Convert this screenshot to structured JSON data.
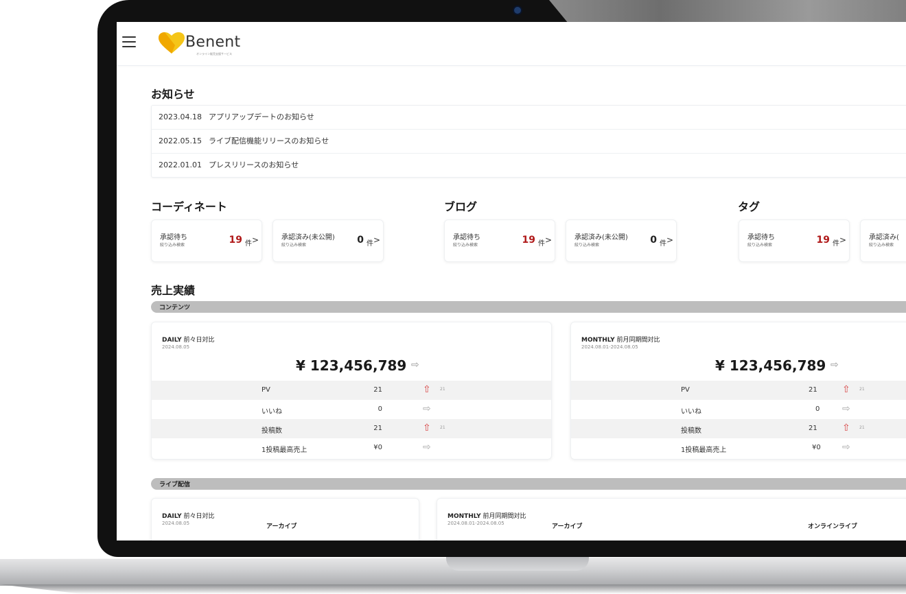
{
  "app": {
    "logo_name": "Benent",
    "logo_tagline": "オンライン販売支援サービス",
    "accent_color": "#b01a1a",
    "logo_color": "#f5c518"
  },
  "news": {
    "title": "お知らせ",
    "items": [
      {
        "date": "2023.04.18",
        "text": "アプリアップデートのお知らせ"
      },
      {
        "date": "2022.05.15",
        "text": "ライブ配信機能リリースのお知らせ"
      },
      {
        "date": "2022.01.01",
        "text": "プレスリリースのお知らせ"
      }
    ]
  },
  "approvals": [
    {
      "title": "コーディネート",
      "pending_label": "承認待ち",
      "pending_sub": "絞り込み検索",
      "pending_count": "19",
      "unit": "件",
      "approved_label": "承認済み(未公開)",
      "approved_sub": "絞り込み検索",
      "approved_count": "0"
    },
    {
      "title": "ブログ",
      "pending_label": "承認待ち",
      "pending_sub": "絞り込み検索",
      "pending_count": "19",
      "unit": "件",
      "approved_label": "承認済み(未公開)",
      "approved_sub": "絞り込み検索",
      "approved_count": "0"
    },
    {
      "title": "タグ",
      "pending_label": "承認待ち",
      "pending_sub": "絞り込み検索",
      "pending_count": "19",
      "unit": "件",
      "approved_label": "承認済み(",
      "approved_sub": "絞り込み検索"
    }
  ],
  "sales": {
    "title": "売上実績",
    "contents_bar": "コンテンツ",
    "daily": {
      "label": "DAILY",
      "compare": "前々日対比",
      "date": "2024.08.05",
      "amount": "¥ 123,456,789"
    },
    "monthly": {
      "label": "MONTHLY",
      "compare": "前月同期間対比",
      "date": "2024.08.01-2024.08.05",
      "amount": "¥ 123,456,789"
    },
    "rows": [
      {
        "name": "PV",
        "value": "21",
        "trend": "up",
        "delta": "21"
      },
      {
        "name": "いいね",
        "value": "0",
        "trend": "flat",
        "delta": ""
      },
      {
        "name": "投稿数",
        "value": "21",
        "trend": "up",
        "delta": "21"
      },
      {
        "name": "1投稿最高売上",
        "value": "¥0",
        "trend": "flat",
        "delta": ""
      }
    ],
    "live_bar": "ライブ配信",
    "live_daily": {
      "label": "DAILY",
      "compare": "前々日対比",
      "date": "2024.08.05",
      "sub": "アーカイブ"
    },
    "live_monthly": {
      "label": "MONTHLY",
      "compare": "前月同期間対比",
      "date": "2024.08.01-2024.08.05",
      "sub_archive": "アーカイブ",
      "sub_online": "オンラインライブ"
    }
  }
}
